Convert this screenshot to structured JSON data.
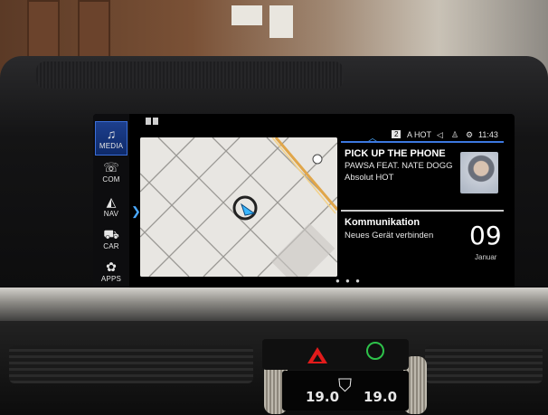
{
  "sidebar": {
    "items": [
      {
        "label": "MEDIA",
        "icon": "music-note-icon",
        "active": true
      },
      {
        "label": "COM",
        "icon": "phone-icon",
        "active": false
      },
      {
        "label": "NAV",
        "icon": "compass-icon",
        "active": false
      },
      {
        "label": "CAR",
        "icon": "car-icon",
        "active": false
      },
      {
        "label": "APPS",
        "icon": "apps-icon",
        "active": false
      }
    ]
  },
  "status_bar": {
    "channel_badge": "2",
    "station": "A HOT",
    "time": "11:43"
  },
  "media": {
    "song": "PICK UP THE PHONE",
    "artist": "PAWSA FEAT. NATE DOGG",
    "station": "Absolut HOT"
  },
  "communication": {
    "title": "Kommunikation",
    "subtitle": "Neues Gerät verbinden",
    "day": "09",
    "month": "Januar"
  },
  "climate": {
    "left_temp": "19.0",
    "right_temp": "19.0"
  },
  "colors": {
    "accent": "#3c78e0",
    "hazard": "#e21b1b",
    "nav_arrow": "#4aa8ff"
  }
}
